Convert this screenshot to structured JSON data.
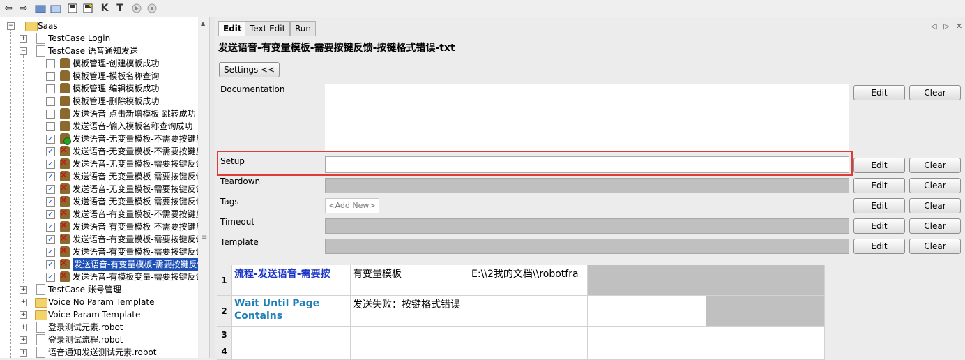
{
  "toolbar": {
    "icons": [
      "back-arrow-icon",
      "forward-arrow-icon",
      "open-folder-icon",
      "new-folder-icon",
      "save-icon",
      "save-all-icon",
      "keyword-search-icon",
      "test-search-icon",
      "run-icon",
      "stop-icon"
    ],
    "keyword_label": "K",
    "test_label": "T"
  },
  "tree": {
    "root": "Saas",
    "items": [
      {
        "label": "TestCase Login",
        "kind": "file"
      },
      {
        "label": "TestCase 语音通知发送",
        "kind": "file"
      },
      {
        "label": "模板管理-创建模板成功",
        "kind": "test",
        "checked": false,
        "status": "none"
      },
      {
        "label": "模板管理-模板名称查询",
        "kind": "test",
        "checked": false,
        "status": "none"
      },
      {
        "label": "模板管理-编辑模板成功",
        "kind": "test",
        "checked": false,
        "status": "none"
      },
      {
        "label": "模板管理-删除模板成功",
        "kind": "test",
        "checked": false,
        "status": "none"
      },
      {
        "label": "发送语音-点击新增模板-跳转成功",
        "kind": "test",
        "checked": false,
        "status": "none"
      },
      {
        "label": "发送语音-输入模板名称查询成功",
        "kind": "test",
        "checked": false,
        "status": "none"
      },
      {
        "label": "发送语音-无变量模板-不需要按键反",
        "kind": "test",
        "checked": true,
        "status": "pass"
      },
      {
        "label": "发送语音-无变量模板-不需要按键反",
        "kind": "test",
        "checked": true,
        "status": "fail"
      },
      {
        "label": "发送语音-无变量模板-需要按键反馈",
        "kind": "test",
        "checked": true,
        "status": "fail"
      },
      {
        "label": "发送语音-无变量模板-需要按键反馈",
        "kind": "test",
        "checked": true,
        "status": "fail"
      },
      {
        "label": "发送语音-无变量模板-需要按键反馈",
        "kind": "test",
        "checked": true,
        "status": "fail"
      },
      {
        "label": "发送语音-无变量模板-需要按键反馈",
        "kind": "test",
        "checked": true,
        "status": "fail"
      },
      {
        "label": "发送语音-有变量模板-不需要按键反",
        "kind": "test",
        "checked": true,
        "status": "fail"
      },
      {
        "label": "发送语音-有变量模板-不需要按键反",
        "kind": "test",
        "checked": true,
        "status": "fail"
      },
      {
        "label": "发送语音-有变量模板-需要按键反馈",
        "kind": "test",
        "checked": true,
        "status": "fail"
      },
      {
        "label": "发送语音-有变量模板-需要按键反馈",
        "kind": "test",
        "checked": true,
        "status": "fail"
      },
      {
        "label": "发送语音-有变量模板-需要按键反馈",
        "kind": "test",
        "checked": true,
        "status": "fail",
        "selected": true
      },
      {
        "label": "发送语音-有模板变量-需要按键反馈",
        "kind": "test",
        "checked": true,
        "status": "fail"
      },
      {
        "label": "TestCase 账号管理",
        "kind": "file"
      },
      {
        "label": "Voice No Param Template",
        "kind": "resource"
      },
      {
        "label": "Voice Param Template",
        "kind": "resource"
      },
      {
        "label": "登录测试元素.robot",
        "kind": "robotfile"
      },
      {
        "label": "登录测试流程.robot",
        "kind": "robotfile"
      },
      {
        "label": "语音通知发送测试元素.robot",
        "kind": "robotfile"
      }
    ]
  },
  "tabs": [
    {
      "label": "Edit",
      "active": true
    },
    {
      "label": "Text Edit",
      "active": false
    },
    {
      "label": "Run",
      "active": false
    }
  ],
  "editor": {
    "title": "发送语音-有变量模板-需要按键反馈-按键格式错误-txt",
    "settings_button": "Settings <<",
    "fields": {
      "documentation": "Documentation",
      "setup": "Setup",
      "teardown": "Teardown",
      "tags": "Tags",
      "timeout": "Timeout",
      "template": "Template"
    },
    "tags_placeholder": "<Add New>",
    "edit_label": "Edit",
    "clear_label": "Clear"
  },
  "grid": {
    "rows": [
      {
        "num": "1",
        "cells": [
          "流程-发送语音-需要按",
          "有变量模板",
          "E:\\\\2我的文档\\\\robotfra",
          "",
          ""
        ]
      },
      {
        "num": "2",
        "cells": [
          "Wait Until Page Contains",
          "发送失败：按键格式错误",
          "",
          "",
          ""
        ]
      },
      {
        "num": "3",
        "cells": [
          "",
          "",
          "",
          "",
          ""
        ]
      },
      {
        "num": "4",
        "cells": [
          "",
          "",
          "",
          "",
          ""
        ]
      }
    ]
  }
}
